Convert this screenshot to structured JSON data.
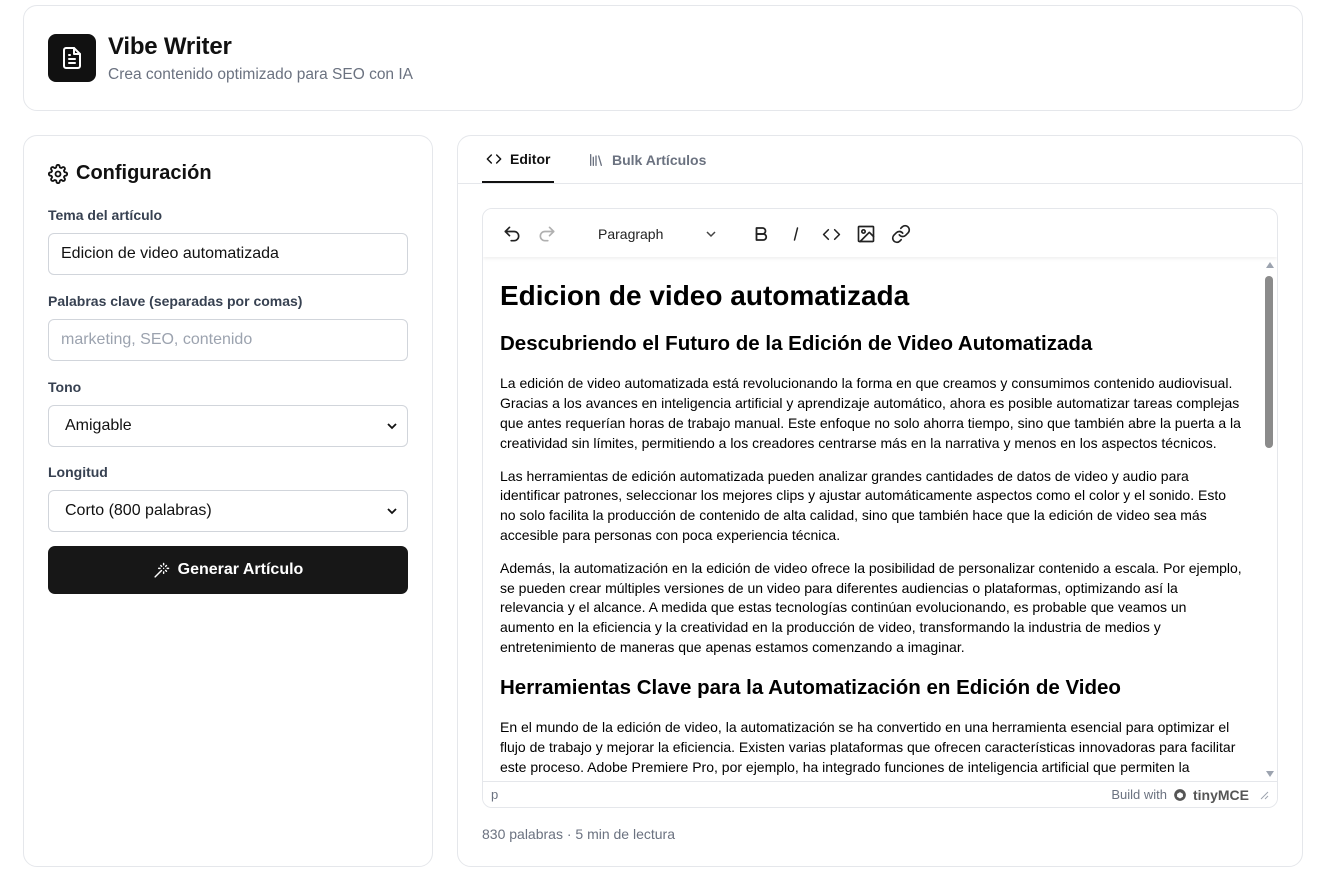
{
  "header": {
    "title": "Vibe Writer",
    "subtitle": "Crea contenido optimizado para SEO con IA"
  },
  "config": {
    "heading": "Configuración",
    "topic_label": "Tema del artículo",
    "topic_value": "Edicion de video automatizada",
    "keywords_label": "Palabras clave (separadas por comas)",
    "keywords_placeholder": "marketing, SEO, contenido",
    "tone_label": "Tono",
    "tone_value": "Amigable",
    "length_label": "Longitud",
    "length_value": "Corto (800 palabras)",
    "generate_label": "Generar Artículo"
  },
  "tabs": {
    "editor": "Editor",
    "bulk": "Bulk Artículos"
  },
  "editor": {
    "block_format": "Paragraph",
    "status_path": "p",
    "brand_prefix": "Build with",
    "brand_name": "tinyMCE",
    "content": {
      "h1": "Edicion de video automatizada",
      "h2_1": "Descubriendo el Futuro de la Edición de Video Automatizada",
      "p1": "La edición de video automatizada está revolucionando la forma en que creamos y consumimos contenido audiovisual. Gracias a los avances en inteligencia artificial y aprendizaje automático, ahora es posible automatizar tareas complejas que antes requerían horas de trabajo manual. Este enfoque no solo ahorra tiempo, sino que también abre la puerta a la creatividad sin límites, permitiendo a los creadores centrarse más en la narrativa y menos en los aspectos técnicos.",
      "p2": "Las herramientas de edición automatizada pueden analizar grandes cantidades de datos de video y audio para identificar patrones, seleccionar los mejores clips y ajustar automáticamente aspectos como el color y el sonido. Esto no solo facilita la producción de contenido de alta calidad, sino que también hace que la edición de video sea más accesible para personas con poca experiencia técnica.",
      "p3": "Además, la automatización en la edición de video ofrece la posibilidad de personalizar contenido a escala. Por ejemplo, se pueden crear múltiples versiones de un video para diferentes audiencias o plataformas, optimizando así la relevancia y el alcance. A medida que estas tecnologías continúan evolucionando, es probable que veamos un aumento en la eficiencia y la creatividad en la producción de video, transformando la industria de medios y entretenimiento de maneras que apenas estamos comenzando a imaginar.",
      "h2_2": "Herramientas Clave para la Automatización en Edición de Video",
      "p4": "En el mundo de la edición de video, la automatización se ha convertido en una herramienta esencial para optimizar el flujo de trabajo y mejorar la eficiencia. Existen varias plataformas que ofrecen características innovadoras para facilitar este proceso. Adobe Premiere Pro, por ejemplo, ha integrado funciones de inteligencia artificial que permiten la"
    }
  },
  "footer": {
    "stats": "830 palabras · 5 min de lectura"
  }
}
